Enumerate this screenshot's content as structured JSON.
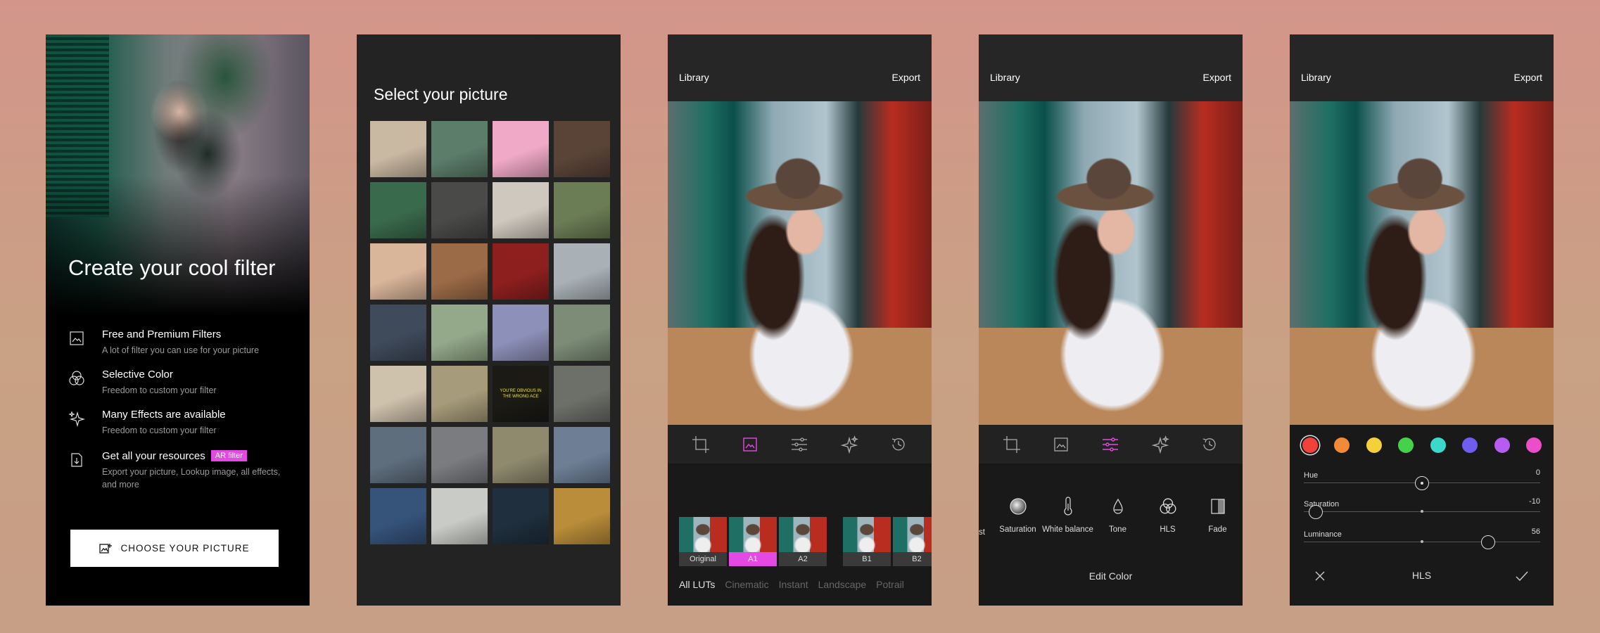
{
  "screen1": {
    "title": "Create your cool filter",
    "features": [
      {
        "title": "Free and Premium Filters",
        "desc": "A lot of filter you can use for your picture"
      },
      {
        "title": "Selective Color",
        "desc": "Freedom to custom your filter"
      },
      {
        "title": "Many Effects are available",
        "desc": "Freedom to custom your filter"
      },
      {
        "title": "Get all your resources",
        "badge": "AR filter",
        "desc": "Export your picture, Lookup image, all effects, and more"
      }
    ],
    "choose_button": "CHOOSE YOUR PICTURE"
  },
  "screen2": {
    "title": "Select your picture",
    "thumb_colors": [
      "#c9b8a2",
      "#5c7d6a",
      "#f0a9c6",
      "#5a4438",
      "#3a6a4c",
      "#4a4a48",
      "#cfc8be",
      "#6b7d55",
      "#d9b59a",
      "#9b6b47",
      "#8e1f1f",
      "#a9b1b6",
      "#3f4a5a",
      "#94a98a",
      "#8d90b8",
      "#7c8c77",
      "#cfc2ad",
      "#a69b7a",
      "#1b1a14",
      "#6d6f69",
      "#5f6e7d",
      "#7a7c80",
      "#8f8a6e",
      "#6e7f95",
      "#36537a",
      "#c9ccc6",
      "#1f2f3d",
      "#b98d3a"
    ],
    "thumb_text": "YOU'RE OBVIOUS IN THE WRONG ACE"
  },
  "editor": {
    "library": "Library",
    "export": "Export"
  },
  "screen3": {
    "filters": [
      {
        "label": "Original"
      },
      {
        "label": "A1"
      },
      {
        "label": "A2"
      },
      {
        "label": "B1"
      },
      {
        "label": "B2"
      }
    ],
    "luts": [
      "All LUTs",
      "Cinematic",
      "Instant",
      "Landscape",
      "Potrail"
    ],
    "accent": "#e549e3"
  },
  "screen4": {
    "partial_label": "st",
    "adjustments": [
      "Saturation",
      "White balance",
      "Tone",
      "HLS",
      "Fade"
    ],
    "panel_title": "Edit Color"
  },
  "screen5": {
    "swatches": [
      "#f1413a",
      "#f28a37",
      "#f4d139",
      "#43d24a",
      "#3ad9c9",
      "#6f5cf0",
      "#b65cf0",
      "#ec4ec9"
    ],
    "hue": {
      "label": "Hue",
      "value": "0",
      "position": 0.5
    },
    "saturation": {
      "label": "Saturation",
      "value": "-10",
      "position": 0.05
    },
    "luminance": {
      "label": "Luminance",
      "value": "56",
      "position": 0.78
    },
    "panel_title": "HLS"
  }
}
